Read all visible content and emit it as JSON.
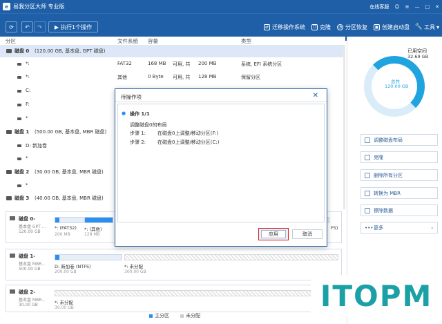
{
  "titlebar": {
    "app_title": "易我分区大师 专业版",
    "online_help": "在线客服",
    "icons": [
      "user-icon",
      "menu-icon",
      "minimize-icon",
      "maximize-icon",
      "close-icon"
    ]
  },
  "toolbar": {
    "refresh_icon": "refresh-icon",
    "undo_icon": "undo-icon",
    "redo_icon": "redo-icon",
    "execute_label": "执行1个操作",
    "tools": [
      {
        "icon": "migrate-os-icon",
        "label": "迁移操作系统"
      },
      {
        "icon": "clone-icon",
        "label": "克隆"
      },
      {
        "icon": "partition-recovery-icon",
        "label": "分区恢复"
      },
      {
        "icon": "bootable-media-icon",
        "label": "创建启动盘"
      },
      {
        "icon": "tools-icon",
        "label": "工具"
      }
    ]
  },
  "table": {
    "columns": [
      "分区",
      "文件系统",
      "容量",
      "类型"
    ],
    "rows": [
      {
        "kind": "disk",
        "name": "磁盘 0",
        "desc": "(120.00 GB, 基本盘, GPT 磁盘)",
        "fs": "",
        "cap": "",
        "type": "",
        "selected": true
      },
      {
        "kind": "part",
        "name": "*:",
        "fs": "FAT32",
        "size": "168 MB",
        "avail_label": "可用, 共",
        "total": "200 MB",
        "type": "系统, EFI 系统分区"
      },
      {
        "kind": "part",
        "name": "*:",
        "fs": "其他",
        "size": "0 Byte",
        "avail_label": "可用, 共",
        "total": "128 MB",
        "type": "保留分区"
      },
      {
        "kind": "part",
        "name": "C:",
        "fs": "",
        "size": "",
        "avail_label": "",
        "total": "",
        "type": ""
      },
      {
        "kind": "part",
        "name": "F:",
        "fs": "",
        "size": "",
        "avail_label": "",
        "total": "",
        "type": ""
      },
      {
        "kind": "part",
        "name": "*",
        "fs": "",
        "size": "",
        "avail_label": "",
        "total": "",
        "type": ""
      },
      {
        "kind": "disk",
        "name": "磁盘 1",
        "desc": "(500.00 GB, 基本盘, MBR 磁盘)"
      },
      {
        "kind": "part",
        "name": "D: 新加卷"
      },
      {
        "kind": "part",
        "name": "*"
      },
      {
        "kind": "disk",
        "name": "磁盘 2",
        "desc": "(30.00 GB, 基本盘, MBR 磁盘)"
      },
      {
        "kind": "part",
        "name": "*"
      },
      {
        "kind": "disk",
        "name": "磁盘 3",
        "desc": "(40.00 GB, 基本盘, MBR 磁盘)"
      }
    ]
  },
  "disk_cards": [
    {
      "name": "磁盘 0-",
      "sub1": "基本盘 GPT ...",
      "sub2": "120.00 GB",
      "parts": [
        {
          "label": "*: (FAT32)",
          "size": "200 MB",
          "fill": 0.16
        },
        {
          "label": "*: (其他)",
          "size": "128 MB",
          "fill": 0.0
        },
        {
          "label": "",
          "size": "",
          "fill": 0.0
        }
      ],
      "right_label": "FS)"
    },
    {
      "name": "磁盘 1-",
      "sub1": "基本盘 MBR...",
      "sub2": "500.00 GB",
      "parts": [
        {
          "label": "D: 新加卷 (NTFS)",
          "size": "200.00 GB",
          "fill": 0.02
        },
        {
          "label": "*: 未分配",
          "size": "300.00 GB",
          "fill": 0.0
        }
      ]
    },
    {
      "name": "磁盘 2-",
      "sub1": "基本盘 MBR...",
      "sub2": "30.00 GB",
      "parts": [
        {
          "label": "*: 未分配",
          "size": "30.00 GB",
          "fill": 0.0
        }
      ]
    }
  ],
  "legend": [
    {
      "label": "主分区",
      "color": "#2b8ff0"
    },
    {
      "label": "未分配",
      "color": "#cccccc"
    }
  ],
  "right_panel": {
    "used_label": "已用空间",
    "used_value": "32.69 GB",
    "total_label": "总共",
    "total_value": "120.00 GB",
    "used_fraction": 0.27,
    "actions": [
      {
        "icon": "adjust-layout-icon",
        "label": "调整磁盘布局"
      },
      {
        "icon": "clone-icon",
        "label": "克隆"
      },
      {
        "icon": "delete-all-icon",
        "label": "删除所有分区"
      },
      {
        "icon": "convert-icon",
        "label": "转换为 MBR"
      },
      {
        "icon": "wipe-icon",
        "label": "擦除数据"
      },
      {
        "icon": "more-icon",
        "label": "更多"
      }
    ]
  },
  "dialog": {
    "title": "待操作项",
    "op_header": "操作 1/1",
    "op_desc": "调整磁盘0的布局",
    "steps": [
      {
        "label": "步骤 1:",
        "text": "在磁盘0上调整/移动分区(F:)"
      },
      {
        "label": "步骤 2:",
        "text": "在磁盘0上调整/移动分区(C:)"
      }
    ],
    "apply_label": "应用",
    "cancel_label": "取消"
  },
  "watermark": {
    "text": "ITOPM"
  }
}
